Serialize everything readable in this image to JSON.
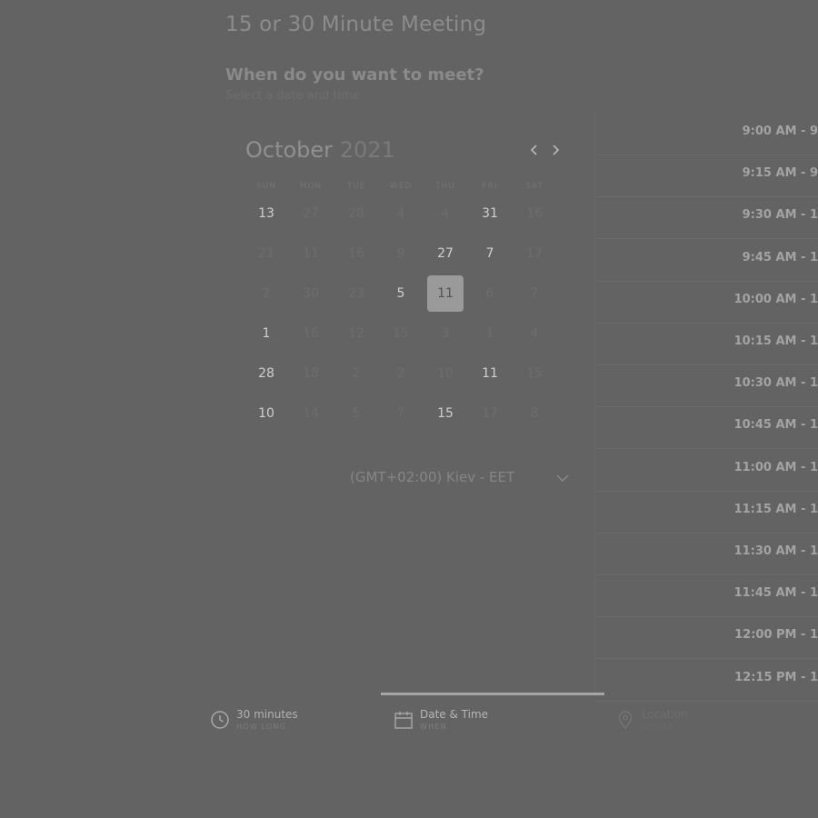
{
  "meeting": {
    "title": "15 or 30 Minute Meeting",
    "question": "When do you want to meet?",
    "subtitle": "Select a date and time"
  },
  "calendar": {
    "month": "October",
    "year": "2021",
    "weekdays": [
      "SUN",
      "MON",
      "TUE",
      "WED",
      "THU",
      "FRI",
      "SAT"
    ],
    "selected_date": "11",
    "weeks": [
      [
        {
          "n": "13",
          "a": true
        },
        {
          "n": "27",
          "a": false
        },
        {
          "n": "28",
          "a": false
        },
        {
          "n": "4",
          "a": false
        },
        {
          "n": "4",
          "a": false
        },
        {
          "n": "31",
          "a": true
        },
        {
          "n": "16",
          "a": false
        }
      ],
      [
        {
          "n": "21",
          "a": false
        },
        {
          "n": "11",
          "a": false
        },
        {
          "n": "16",
          "a": false
        },
        {
          "n": "9",
          "a": false
        },
        {
          "n": "27",
          "a": true
        },
        {
          "n": "7",
          "a": true
        },
        {
          "n": "17",
          "a": false
        }
      ],
      [
        {
          "n": "2",
          "a": false
        },
        {
          "n": "30",
          "a": false
        },
        {
          "n": "23",
          "a": false
        },
        {
          "n": "5",
          "a": true
        },
        {
          "n": "11",
          "a": true,
          "s": true
        },
        {
          "n": "6",
          "a": false
        },
        {
          "n": "7",
          "a": false
        }
      ],
      [
        {
          "n": "1",
          "a": true
        },
        {
          "n": "16",
          "a": false
        },
        {
          "n": "12",
          "a": false
        },
        {
          "n": "15",
          "a": false
        },
        {
          "n": "3",
          "a": false
        },
        {
          "n": "1",
          "a": false
        },
        {
          "n": "4",
          "a": false
        }
      ],
      [
        {
          "n": "28",
          "a": true
        },
        {
          "n": "18",
          "a": false
        },
        {
          "n": "2",
          "a": false
        },
        {
          "n": "2",
          "a": false
        },
        {
          "n": "10",
          "a": false
        },
        {
          "n": "11",
          "a": true
        },
        {
          "n": "15",
          "a": false
        }
      ],
      [
        {
          "n": "10",
          "a": true
        },
        {
          "n": "14",
          "a": false
        },
        {
          "n": "5",
          "a": false
        },
        {
          "n": "7",
          "a": false
        },
        {
          "n": "15",
          "a": true
        },
        {
          "n": "17",
          "a": false
        },
        {
          "n": "8",
          "a": false
        }
      ]
    ]
  },
  "timezone": {
    "label": "(GMT+02:00) Kiev - EET"
  },
  "time_slots": [
    "9:00 AM - 9",
    "9:15 AM - 9",
    "9:30 AM - 1",
    "9:45 AM - 1",
    "10:00 AM - 1",
    "10:15 AM - 1",
    "10:30 AM - 1",
    "10:45 AM - 1",
    "11:00 AM - 1",
    "11:15 AM - 1",
    "11:30 AM - 1",
    "11:45 AM - 1",
    "12:00 PM - 1",
    "12:15 PM - 1"
  ],
  "steps": {
    "duration": {
      "label": "30 minutes",
      "sub": "HOW LONG",
      "icon": "clock-icon"
    },
    "when": {
      "label": "Date & Time",
      "sub": "WHEN",
      "icon": "calendar-icon"
    },
    "location": {
      "label": "Location",
      "sub": "WHERE",
      "icon": "map-pin-icon"
    }
  }
}
